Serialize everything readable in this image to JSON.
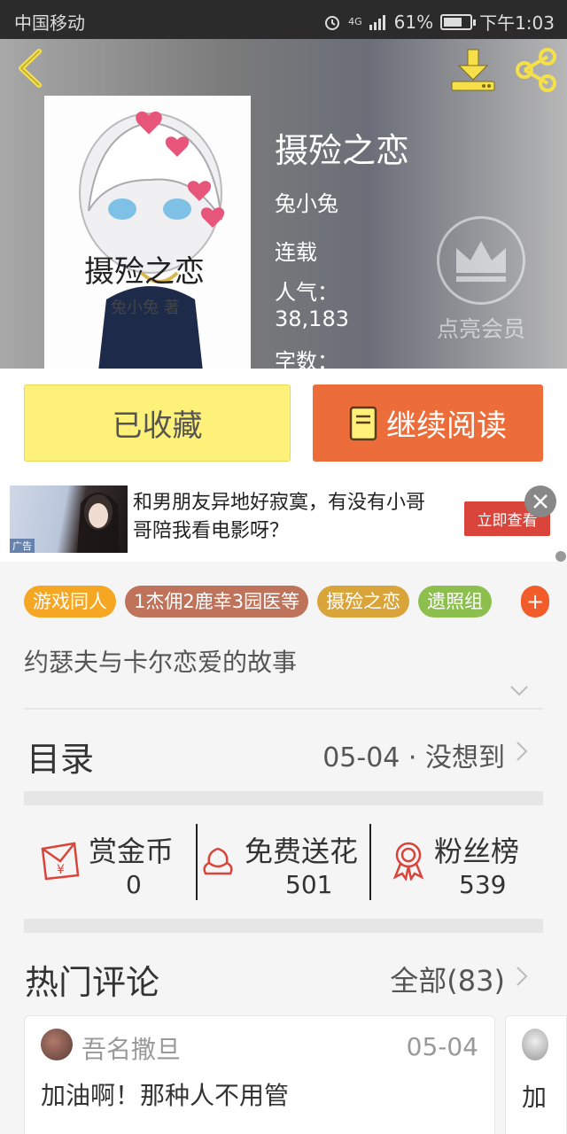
{
  "status_bar": {
    "carrier": "中国移动",
    "network": "4G",
    "battery": "61%",
    "time": "下午1:03",
    "battery_level": 0.61
  },
  "book": {
    "title": "摄殓之恋",
    "author": "兔小兔",
    "status": "连载",
    "popularity_label": "人气：",
    "popularity_value": "38,183",
    "word_count_label": "字数："
  },
  "cover": {
    "title": "摄殓之恋",
    "author_line": "兔小兔 著"
  },
  "vip": {
    "label": "点亮会员"
  },
  "actions": {
    "favorite_label": "已收藏",
    "read_label": "继续阅读"
  },
  "ad": {
    "text": "和男朋友异地好寂寞，有没有小哥哥陪我看电影呀？",
    "cta": "立即查看",
    "tag": "广告"
  },
  "tags": [
    {
      "label": "游戏同人",
      "color": "#f5a623"
    },
    {
      "label": "1杰佣2鹿幸3园医等",
      "color": "#c0735b"
    },
    {
      "label": "摄殓之恋",
      "color": "#d9a43a"
    },
    {
      "label": "遗照组",
      "color": "#8cbf4e"
    }
  ],
  "tag_more": "+",
  "summary": "约瑟夫与卡尔恋爱的故事",
  "toc": {
    "label": "目录",
    "latest": "05-04 · 没想到"
  },
  "stats": [
    {
      "label": "赏金币",
      "value": "0"
    },
    {
      "label": "免费送花",
      "value": "501"
    },
    {
      "label": "粉丝榜",
      "value": "539"
    }
  ],
  "comments_section": {
    "title": "热门评论",
    "all_label": "全部(83)"
  },
  "comments": [
    {
      "user": "吾名撒旦",
      "date": "05-04",
      "text": "加油啊！那种人不用管"
    }
  ],
  "comment_peek": {
    "text": "加"
  },
  "colors": {
    "accent_orange": "#ec6d3a",
    "favorite_yellow": "#fef17a",
    "icon_yellow": "#f5e04a",
    "icon_red": "#d9453b"
  }
}
